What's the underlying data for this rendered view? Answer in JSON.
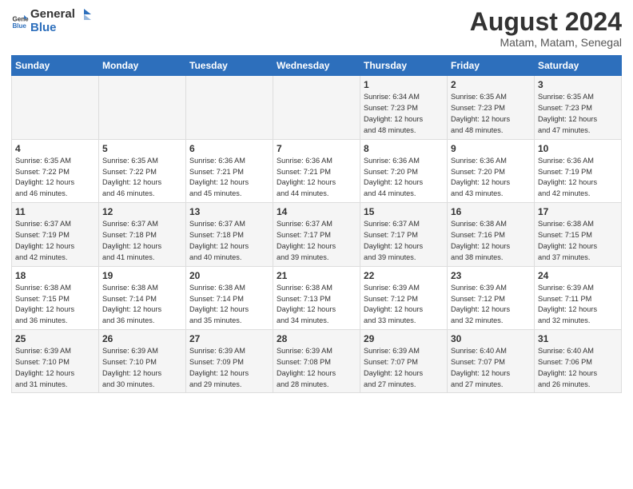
{
  "header": {
    "logo_general": "General",
    "logo_blue": "Blue",
    "month_year": "August 2024",
    "location": "Matam, Matam, Senegal"
  },
  "weekdays": [
    "Sunday",
    "Monday",
    "Tuesday",
    "Wednesday",
    "Thursday",
    "Friday",
    "Saturday"
  ],
  "weeks": [
    [
      {
        "day": "",
        "content": ""
      },
      {
        "day": "",
        "content": ""
      },
      {
        "day": "",
        "content": ""
      },
      {
        "day": "",
        "content": ""
      },
      {
        "day": "1",
        "content": "Sunrise: 6:34 AM\nSunset: 7:23 PM\nDaylight: 12 hours\nand 48 minutes."
      },
      {
        "day": "2",
        "content": "Sunrise: 6:35 AM\nSunset: 7:23 PM\nDaylight: 12 hours\nand 48 minutes."
      },
      {
        "day": "3",
        "content": "Sunrise: 6:35 AM\nSunset: 7:23 PM\nDaylight: 12 hours\nand 47 minutes."
      }
    ],
    [
      {
        "day": "4",
        "content": "Sunrise: 6:35 AM\nSunset: 7:22 PM\nDaylight: 12 hours\nand 46 minutes."
      },
      {
        "day": "5",
        "content": "Sunrise: 6:35 AM\nSunset: 7:22 PM\nDaylight: 12 hours\nand 46 minutes."
      },
      {
        "day": "6",
        "content": "Sunrise: 6:36 AM\nSunset: 7:21 PM\nDaylight: 12 hours\nand 45 minutes."
      },
      {
        "day": "7",
        "content": "Sunrise: 6:36 AM\nSunset: 7:21 PM\nDaylight: 12 hours\nand 44 minutes."
      },
      {
        "day": "8",
        "content": "Sunrise: 6:36 AM\nSunset: 7:20 PM\nDaylight: 12 hours\nand 44 minutes."
      },
      {
        "day": "9",
        "content": "Sunrise: 6:36 AM\nSunset: 7:20 PM\nDaylight: 12 hours\nand 43 minutes."
      },
      {
        "day": "10",
        "content": "Sunrise: 6:36 AM\nSunset: 7:19 PM\nDaylight: 12 hours\nand 42 minutes."
      }
    ],
    [
      {
        "day": "11",
        "content": "Sunrise: 6:37 AM\nSunset: 7:19 PM\nDaylight: 12 hours\nand 42 minutes."
      },
      {
        "day": "12",
        "content": "Sunrise: 6:37 AM\nSunset: 7:18 PM\nDaylight: 12 hours\nand 41 minutes."
      },
      {
        "day": "13",
        "content": "Sunrise: 6:37 AM\nSunset: 7:18 PM\nDaylight: 12 hours\nand 40 minutes."
      },
      {
        "day": "14",
        "content": "Sunrise: 6:37 AM\nSunset: 7:17 PM\nDaylight: 12 hours\nand 39 minutes."
      },
      {
        "day": "15",
        "content": "Sunrise: 6:37 AM\nSunset: 7:17 PM\nDaylight: 12 hours\nand 39 minutes."
      },
      {
        "day": "16",
        "content": "Sunrise: 6:38 AM\nSunset: 7:16 PM\nDaylight: 12 hours\nand 38 minutes."
      },
      {
        "day": "17",
        "content": "Sunrise: 6:38 AM\nSunset: 7:15 PM\nDaylight: 12 hours\nand 37 minutes."
      }
    ],
    [
      {
        "day": "18",
        "content": "Sunrise: 6:38 AM\nSunset: 7:15 PM\nDaylight: 12 hours\nand 36 minutes."
      },
      {
        "day": "19",
        "content": "Sunrise: 6:38 AM\nSunset: 7:14 PM\nDaylight: 12 hours\nand 36 minutes."
      },
      {
        "day": "20",
        "content": "Sunrise: 6:38 AM\nSunset: 7:14 PM\nDaylight: 12 hours\nand 35 minutes."
      },
      {
        "day": "21",
        "content": "Sunrise: 6:38 AM\nSunset: 7:13 PM\nDaylight: 12 hours\nand 34 minutes."
      },
      {
        "day": "22",
        "content": "Sunrise: 6:39 AM\nSunset: 7:12 PM\nDaylight: 12 hours\nand 33 minutes."
      },
      {
        "day": "23",
        "content": "Sunrise: 6:39 AM\nSunset: 7:12 PM\nDaylight: 12 hours\nand 32 minutes."
      },
      {
        "day": "24",
        "content": "Sunrise: 6:39 AM\nSunset: 7:11 PM\nDaylight: 12 hours\nand 32 minutes."
      }
    ],
    [
      {
        "day": "25",
        "content": "Sunrise: 6:39 AM\nSunset: 7:10 PM\nDaylight: 12 hours\nand 31 minutes."
      },
      {
        "day": "26",
        "content": "Sunrise: 6:39 AM\nSunset: 7:10 PM\nDaylight: 12 hours\nand 30 minutes."
      },
      {
        "day": "27",
        "content": "Sunrise: 6:39 AM\nSunset: 7:09 PM\nDaylight: 12 hours\nand 29 minutes."
      },
      {
        "day": "28",
        "content": "Sunrise: 6:39 AM\nSunset: 7:08 PM\nDaylight: 12 hours\nand 28 minutes."
      },
      {
        "day": "29",
        "content": "Sunrise: 6:39 AM\nSunset: 7:07 PM\nDaylight: 12 hours\nand 27 minutes."
      },
      {
        "day": "30",
        "content": "Sunrise: 6:40 AM\nSunset: 7:07 PM\nDaylight: 12 hours\nand 27 minutes."
      },
      {
        "day": "31",
        "content": "Sunrise: 6:40 AM\nSunset: 7:06 PM\nDaylight: 12 hours\nand 26 minutes."
      }
    ]
  ]
}
